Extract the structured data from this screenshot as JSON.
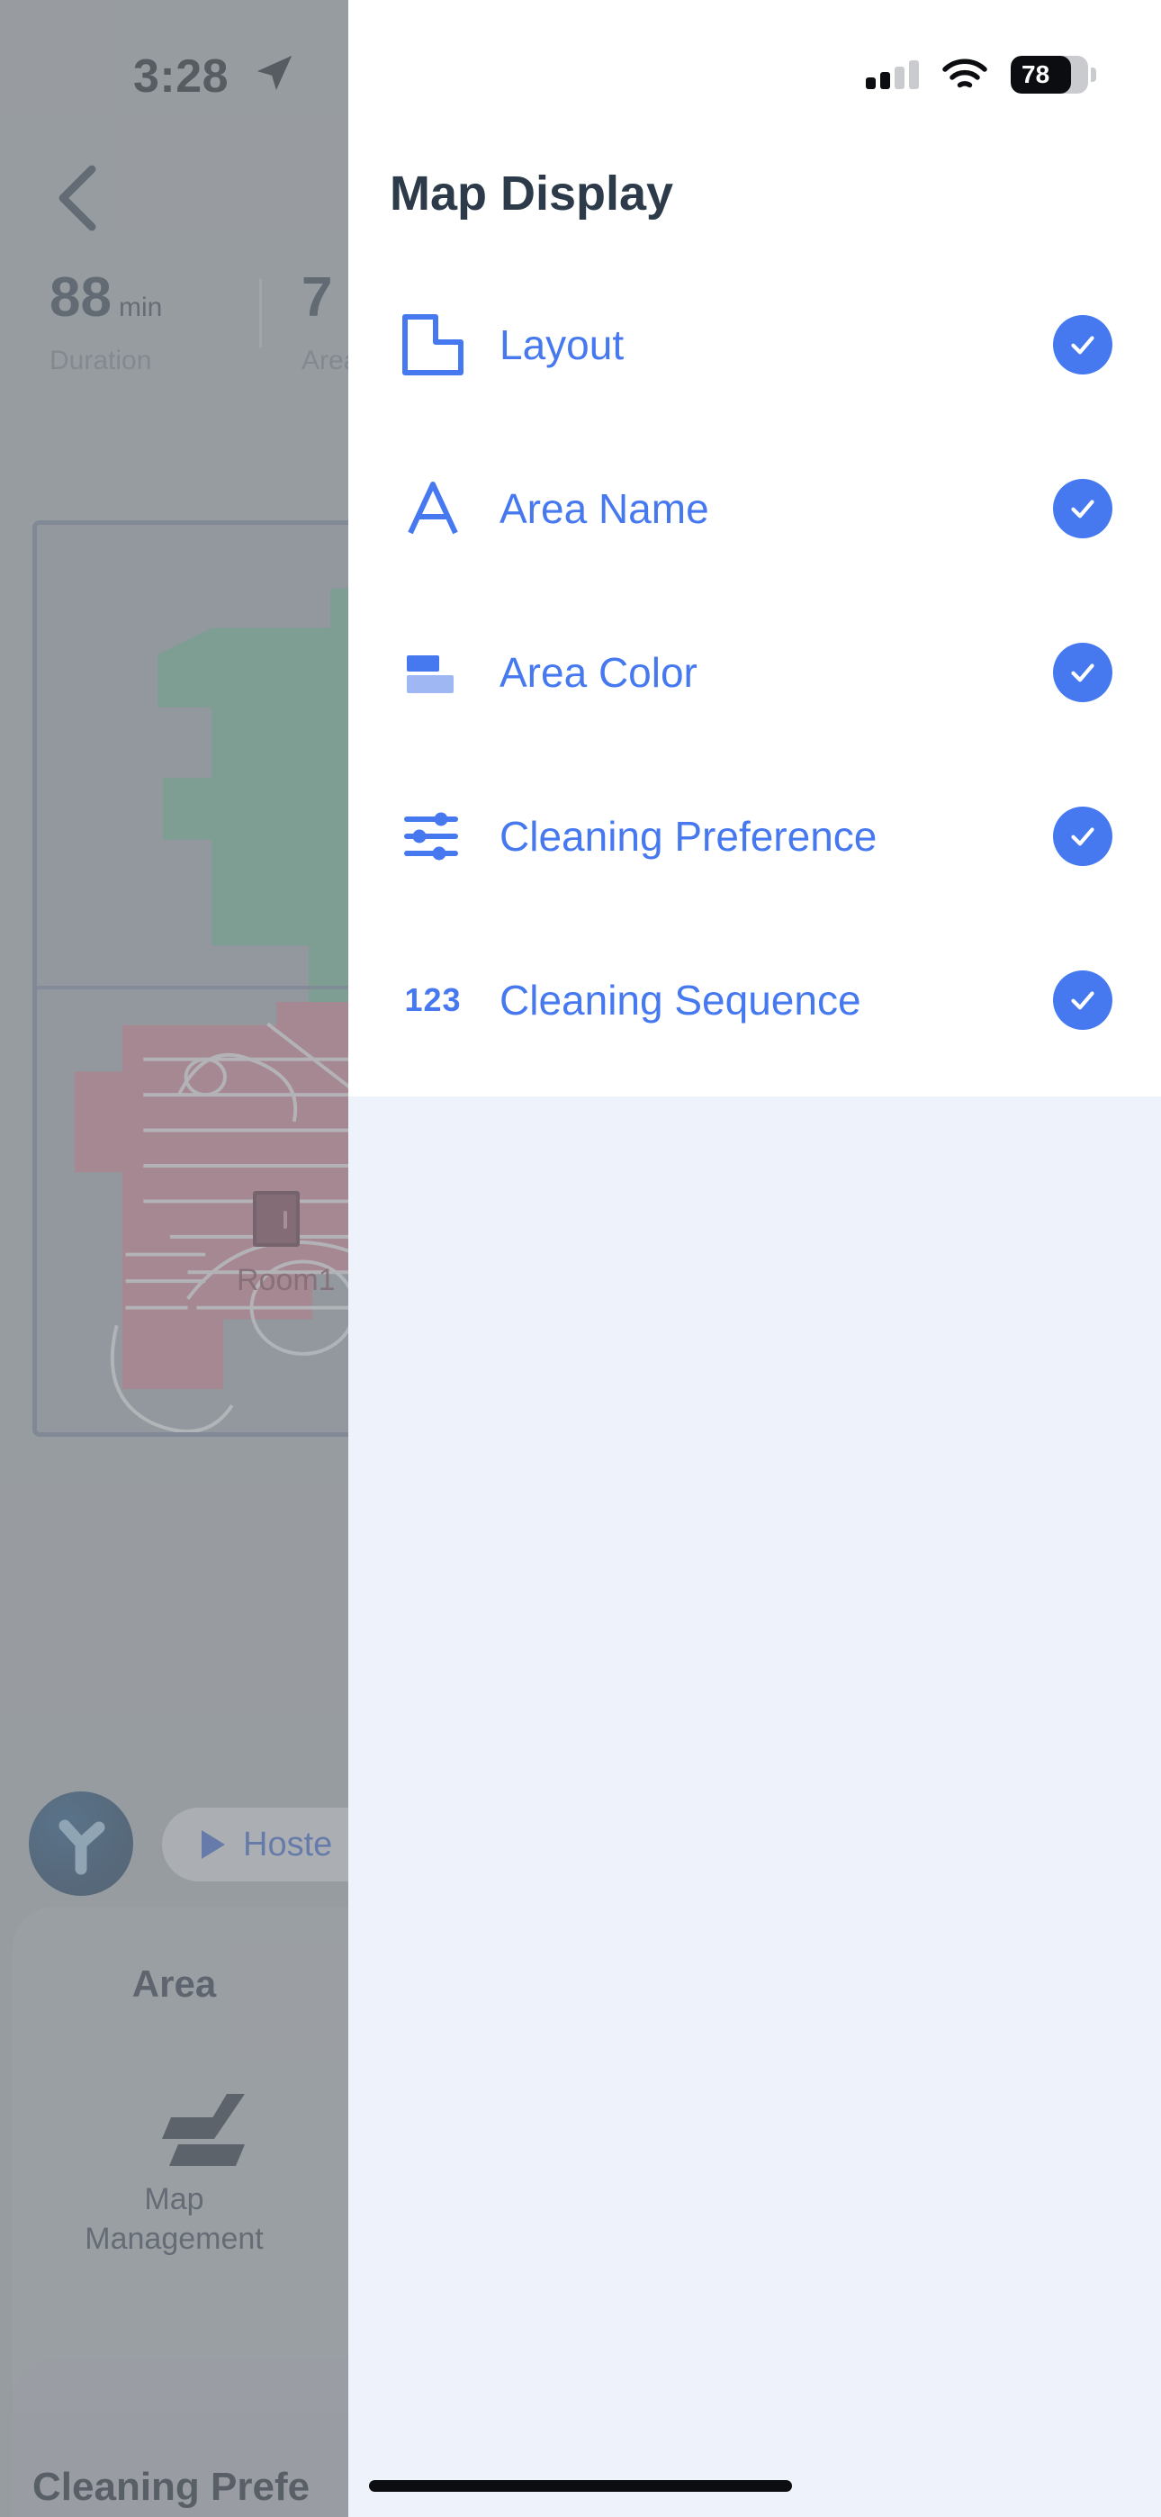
{
  "status_bar": {
    "time": "3:28",
    "location_icon": "location-arrow-icon",
    "signal_icon": "cellular-signal-icon",
    "signal_bars_filled": 2,
    "signal_bars_total": 4,
    "wifi_icon": "wifi-icon",
    "battery_icon": "battery-icon",
    "battery_percent": "78",
    "battery_level": 78
  },
  "panel": {
    "title": "Map Display",
    "accent_color": "#4679ef",
    "title_color": "#2c3a49",
    "background_color": "#ffffff",
    "page_background_color": "#eef2fa",
    "items": [
      {
        "label": "Layout",
        "icon": "floorplan-icon",
        "checked": true
      },
      {
        "label": "Area Name",
        "icon": "letter-a-icon",
        "checked": true
      },
      {
        "label": "Area Color",
        "icon": "color-swatch-icon",
        "checked": true
      },
      {
        "label": "Cleaning Preference",
        "icon": "sliders-icon",
        "checked": true
      },
      {
        "label": "Cleaning Sequence",
        "icon": "123-icon",
        "checked": true,
        "icon_text": "123"
      }
    ],
    "check_glyph": "check-icon"
  },
  "background_app": {
    "back_button_icon": "chevron-left-icon",
    "stats": [
      {
        "value": "88",
        "unit": "min",
        "label": "Duration"
      },
      {
        "value": "7",
        "unit": "",
        "label": "Area"
      }
    ],
    "map": {
      "room_label": "Room1",
      "dock_icon": "charging-dock-icon",
      "green_area_color": "#62a383",
      "red_area_color": "#b9717f",
      "frame_color": "#69738c"
    },
    "robot_logo_icon": "robot-brand-logo",
    "status_pill": {
      "play_icon": "play-icon",
      "text": "Hoste"
    },
    "bottom_sheet": {
      "title": "Area",
      "tool": {
        "icon": "map-layers-icon",
        "label": "Map\nManagement"
      }
    },
    "second_sheet_title": "Cleaning Prefe"
  },
  "home_indicator": "home-indicator-bar"
}
